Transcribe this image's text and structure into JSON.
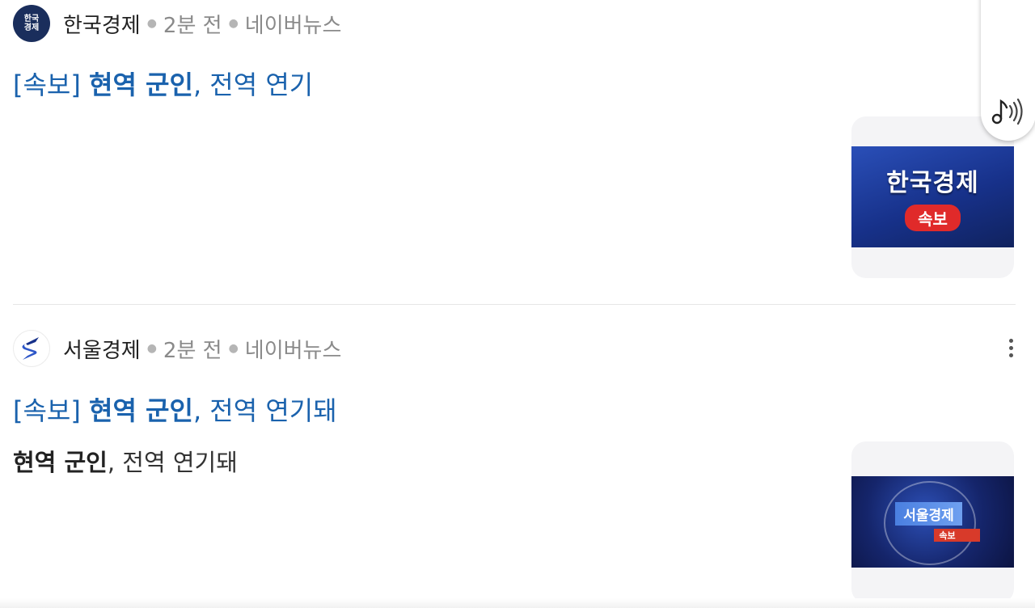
{
  "results": [
    {
      "source": {
        "name": "한국경제",
        "logo_line1": "한국",
        "logo_line2": "경제",
        "time": "2분 전",
        "platform": "네이버뉴스"
      },
      "title": {
        "prefix": "[속보] ",
        "highlight": "현역 군인",
        "rest": ", 전역 연기"
      },
      "thumbnail": {
        "title": "한국경제",
        "badge": "속보"
      }
    },
    {
      "source": {
        "name": "서울경제",
        "time": "2분 전",
        "platform": "네이버뉴스"
      },
      "title": {
        "prefix": "[속보] ",
        "highlight": "현역 군인",
        "rest": ", 전역 연기돼"
      },
      "snippet": {
        "highlight": "현역 군인",
        "rest": ", 전역 연기돼"
      },
      "thumbnail": {
        "title": "서울경제",
        "badge": "속보"
      }
    }
  ],
  "icons": {
    "audio": "audio-listen-icon",
    "more": "more-vertical-icon"
  },
  "colors": {
    "title_link": "#1a62ad",
    "hk_logo_bg": "#1a2e5c",
    "se_logo_accent": "#2d56c8",
    "badge_red": "#e02a2a"
  }
}
